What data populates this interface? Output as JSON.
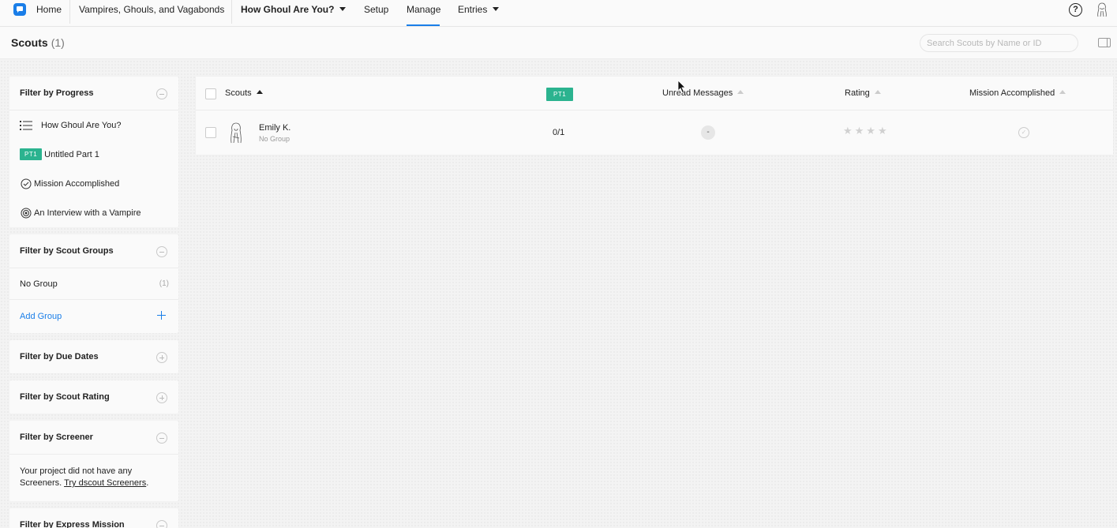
{
  "topbar": {
    "home": "Home",
    "project": "Vampires, Ghouls, and Vagabonds",
    "mission": "How Ghoul Are You?",
    "setup": "Setup",
    "manage": "Manage",
    "entries": "Entries",
    "help": "?"
  },
  "header": {
    "title": "Scouts",
    "count": "(1)",
    "search_placeholder": "Search Scouts by Name or ID"
  },
  "filters": {
    "progress": {
      "title": "Filter by Progress",
      "items": [
        {
          "label": "How Ghoul Are You?",
          "icon": "list-icon"
        },
        {
          "badge": "PT1",
          "label": "Untitled Part 1"
        },
        {
          "label": "Mission Accomplished",
          "icon": "check-circle-icon"
        },
        {
          "label": "An Interview with a Vampire",
          "icon": "target-icon"
        }
      ]
    },
    "groups": {
      "title": "Filter by Scout Groups",
      "no_group": "No Group",
      "no_group_count": "(1)",
      "add_group": "Add Group"
    },
    "due_dates": {
      "title": "Filter by Due Dates"
    },
    "rating": {
      "title": "Filter by Scout Rating"
    },
    "screener": {
      "title": "Filter by Screener",
      "text": "Your project did not have any Screeners.",
      "link": "Try dscout Screeners",
      "suffix": "."
    },
    "express": {
      "title": "Filter by Express Mission"
    }
  },
  "table": {
    "columns": {
      "scouts": "Scouts",
      "part_badge": "PT1",
      "unread": "Unread Messages",
      "rating": "Rating",
      "accomplished": "Mission Accomplished"
    },
    "rows": [
      {
        "name": "Emily K.",
        "group": "No Group",
        "progress": "0/1",
        "unread": "-",
        "stars": "★★★★",
        "accomplished": "✓"
      }
    ]
  },
  "colors": {
    "accent": "#1a7ee8",
    "badge": "#2bb38f"
  }
}
